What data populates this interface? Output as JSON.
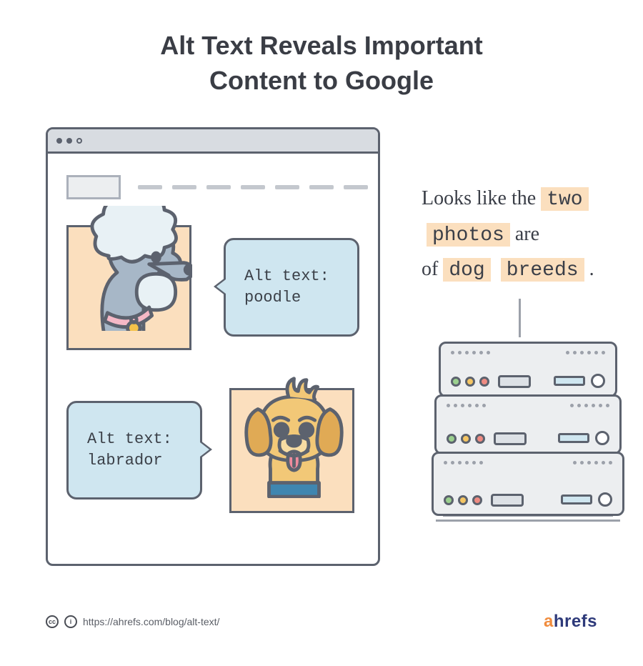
{
  "title_line1": "Alt Text Reveals Important",
  "title_line2": "Content to Google",
  "images": {
    "poodle": {
      "alt_label_line1": "Alt text:",
      "alt_label_line2": "poodle"
    },
    "labrador": {
      "alt_label_line1": "Alt text:",
      "alt_label_line2": "labrador"
    }
  },
  "quote": {
    "lead": "Looks like the ",
    "w1": "two",
    "w2": "photos",
    "mid1": " are",
    "mid2": "of ",
    "w3": "dog",
    "w4": "breeds",
    "tail": " ."
  },
  "footer": {
    "cc_label": "cc",
    "by_label": "i",
    "url": "https://ahrefs.com/blog/alt-text/",
    "brand_a": "a",
    "brand_rest": "hrefs"
  },
  "icons": {
    "poodle": "poodle-dog-icon",
    "labrador": "labrador-dog-icon",
    "server": "server-rack-icon"
  }
}
